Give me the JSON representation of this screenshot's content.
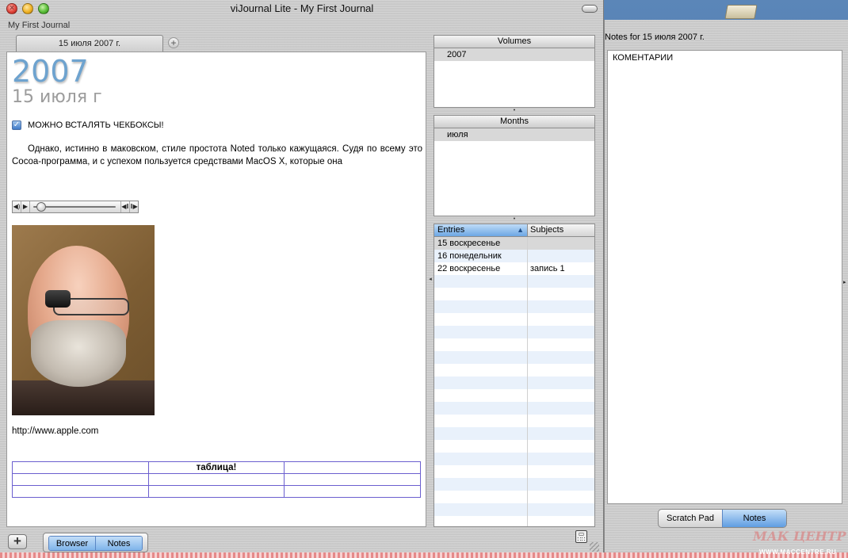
{
  "window": {
    "title": "viJournal Lite - My First Journal"
  },
  "journal": {
    "name": "My First Journal"
  },
  "tabs": [
    {
      "label": "15 июля 2007 г."
    }
  ],
  "entry": {
    "year": "2007",
    "date": "15 июля г",
    "checkbox_label": "МОЖНО ВСТАЛЯТЬ ЧЕКБОКСЫ!",
    "checkbox_checked": true,
    "body": "Однако, истинно в маковском, стиле простота Noted только кажущаяся. Судя по всему это Cocoa-программа, и с успехом пользуется средствами MacOS X, которые она",
    "link": "http://www.apple.com",
    "table": {
      "rows": [
        [
          "",
          "таблица!",
          ""
        ],
        [
          "",
          "",
          ""
        ],
        [
          "",
          "",
          ""
        ]
      ]
    }
  },
  "volumes": {
    "header": "Volumes",
    "items": [
      "2007"
    ]
  },
  "months": {
    "header": "Months",
    "items": [
      "июля"
    ]
  },
  "entries": {
    "columns": [
      "Entries",
      "Subjects"
    ],
    "rows": [
      {
        "entry": "15 воскресенье",
        "subject": ""
      },
      {
        "entry": "16 понедельник",
        "subject": ""
      },
      {
        "entry": "22 воскресенье",
        "subject": "запись 1"
      }
    ]
  },
  "bottom_bar": {
    "add_icon": "plus-icon",
    "segments": [
      "Browser",
      "Notes"
    ]
  },
  "notes": {
    "title": "Notes for 15 июля 2007 г.",
    "text": "КОМЕНТАРИИ",
    "segments": [
      "Scratch Pad",
      "Notes"
    ],
    "active_segment": "Notes"
  },
  "watermark": {
    "text": "МАК ЦЕНТР",
    "url": "WWW.MACCENTRE.RU"
  },
  "colors": {
    "year": "#6ea3cf",
    "selected_segment": "#7fb4ea",
    "table_border": "#6b5fcf"
  }
}
